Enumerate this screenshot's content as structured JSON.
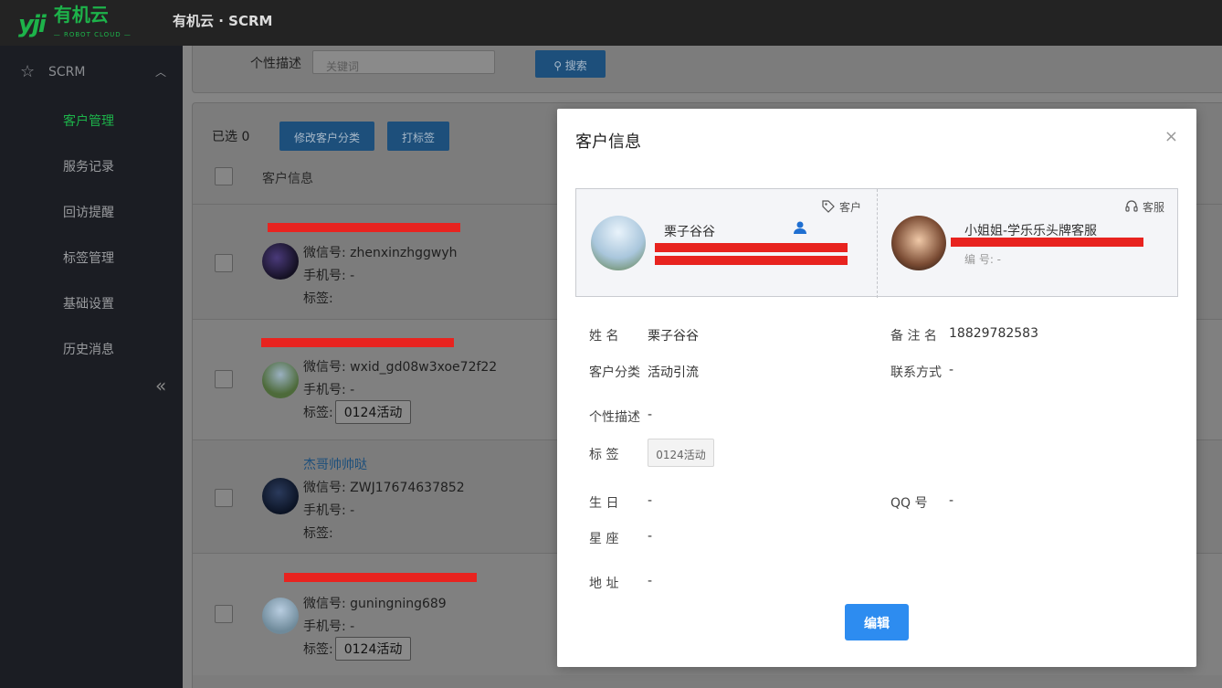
{
  "app": {
    "logo_mark": "yji",
    "logo_text": "有机云",
    "logo_sub": "— ROBOT CLOUD —",
    "title": "有机云 · SCRM"
  },
  "sidebar": {
    "section": "SCRM",
    "items": [
      {
        "label": "客户管理",
        "active": true
      },
      {
        "label": "服务记录"
      },
      {
        "label": "回访提醒"
      },
      {
        "label": "标签管理"
      },
      {
        "label": "基础设置"
      },
      {
        "label": "历史消息"
      }
    ],
    "collapse_icon": "«"
  },
  "filter": {
    "label": "个性描述",
    "placeholder": "关键词",
    "search_label": "搜索"
  },
  "toolbar": {
    "selected": "已选 0",
    "change_category": "修改客户分类",
    "tag": "打标签"
  },
  "table": {
    "header": "客户信息",
    "rows": [
      {
        "wechat": "微信号: zhenxinzhggwyh",
        "phone": "手机号: -",
        "tags_label": "标签:",
        "tag": ""
      },
      {
        "wechat": "微信号: wxid_gd08w3xoe72f22",
        "phone": "手机号: -",
        "tags_label": "标签:",
        "tag": "0124活动"
      },
      {
        "name": "杰哥帅帅哒",
        "wechat": "微信号: ZWJ17674637852",
        "phone": "手机号: -",
        "tags_label": "标签:",
        "tag": ""
      },
      {
        "wechat": "微信号: guningning689",
        "phone": "手机号: -",
        "tags_label": "标签:",
        "tag": "0124活动"
      }
    ]
  },
  "modal": {
    "title": "客户信息",
    "close": "×",
    "customer_card": {
      "tag": "客户",
      "name": "栗子谷谷"
    },
    "service_card": {
      "tag": "客服",
      "name": "小姐姐-学乐乐头牌客服",
      "id_line": "编  号: -"
    },
    "fields": {
      "name_label": "姓      名",
      "name_value": "栗子谷谷",
      "remark_label": "备 注 名",
      "remark_value": "18829782583",
      "category_label": "客户分类",
      "category_value": "活动引流",
      "contact_label": "联系方式",
      "contact_value": "-",
      "desc_label": "个性描述",
      "desc_value": "-",
      "tags_label": "标      签",
      "tag_value": "0124活动",
      "birthday_label": "生      日",
      "birthday_value": "-",
      "qq_label": "QQ      号",
      "qq_value": "-",
      "zodiac_label": "星      座",
      "zodiac_value": "-",
      "address_label": "地      址",
      "address_value": "-"
    },
    "edit_label": "编辑"
  },
  "colors": {
    "accent": "#1db34a",
    "primary": "#2d8cf0",
    "redaction": "#e8231f"
  }
}
